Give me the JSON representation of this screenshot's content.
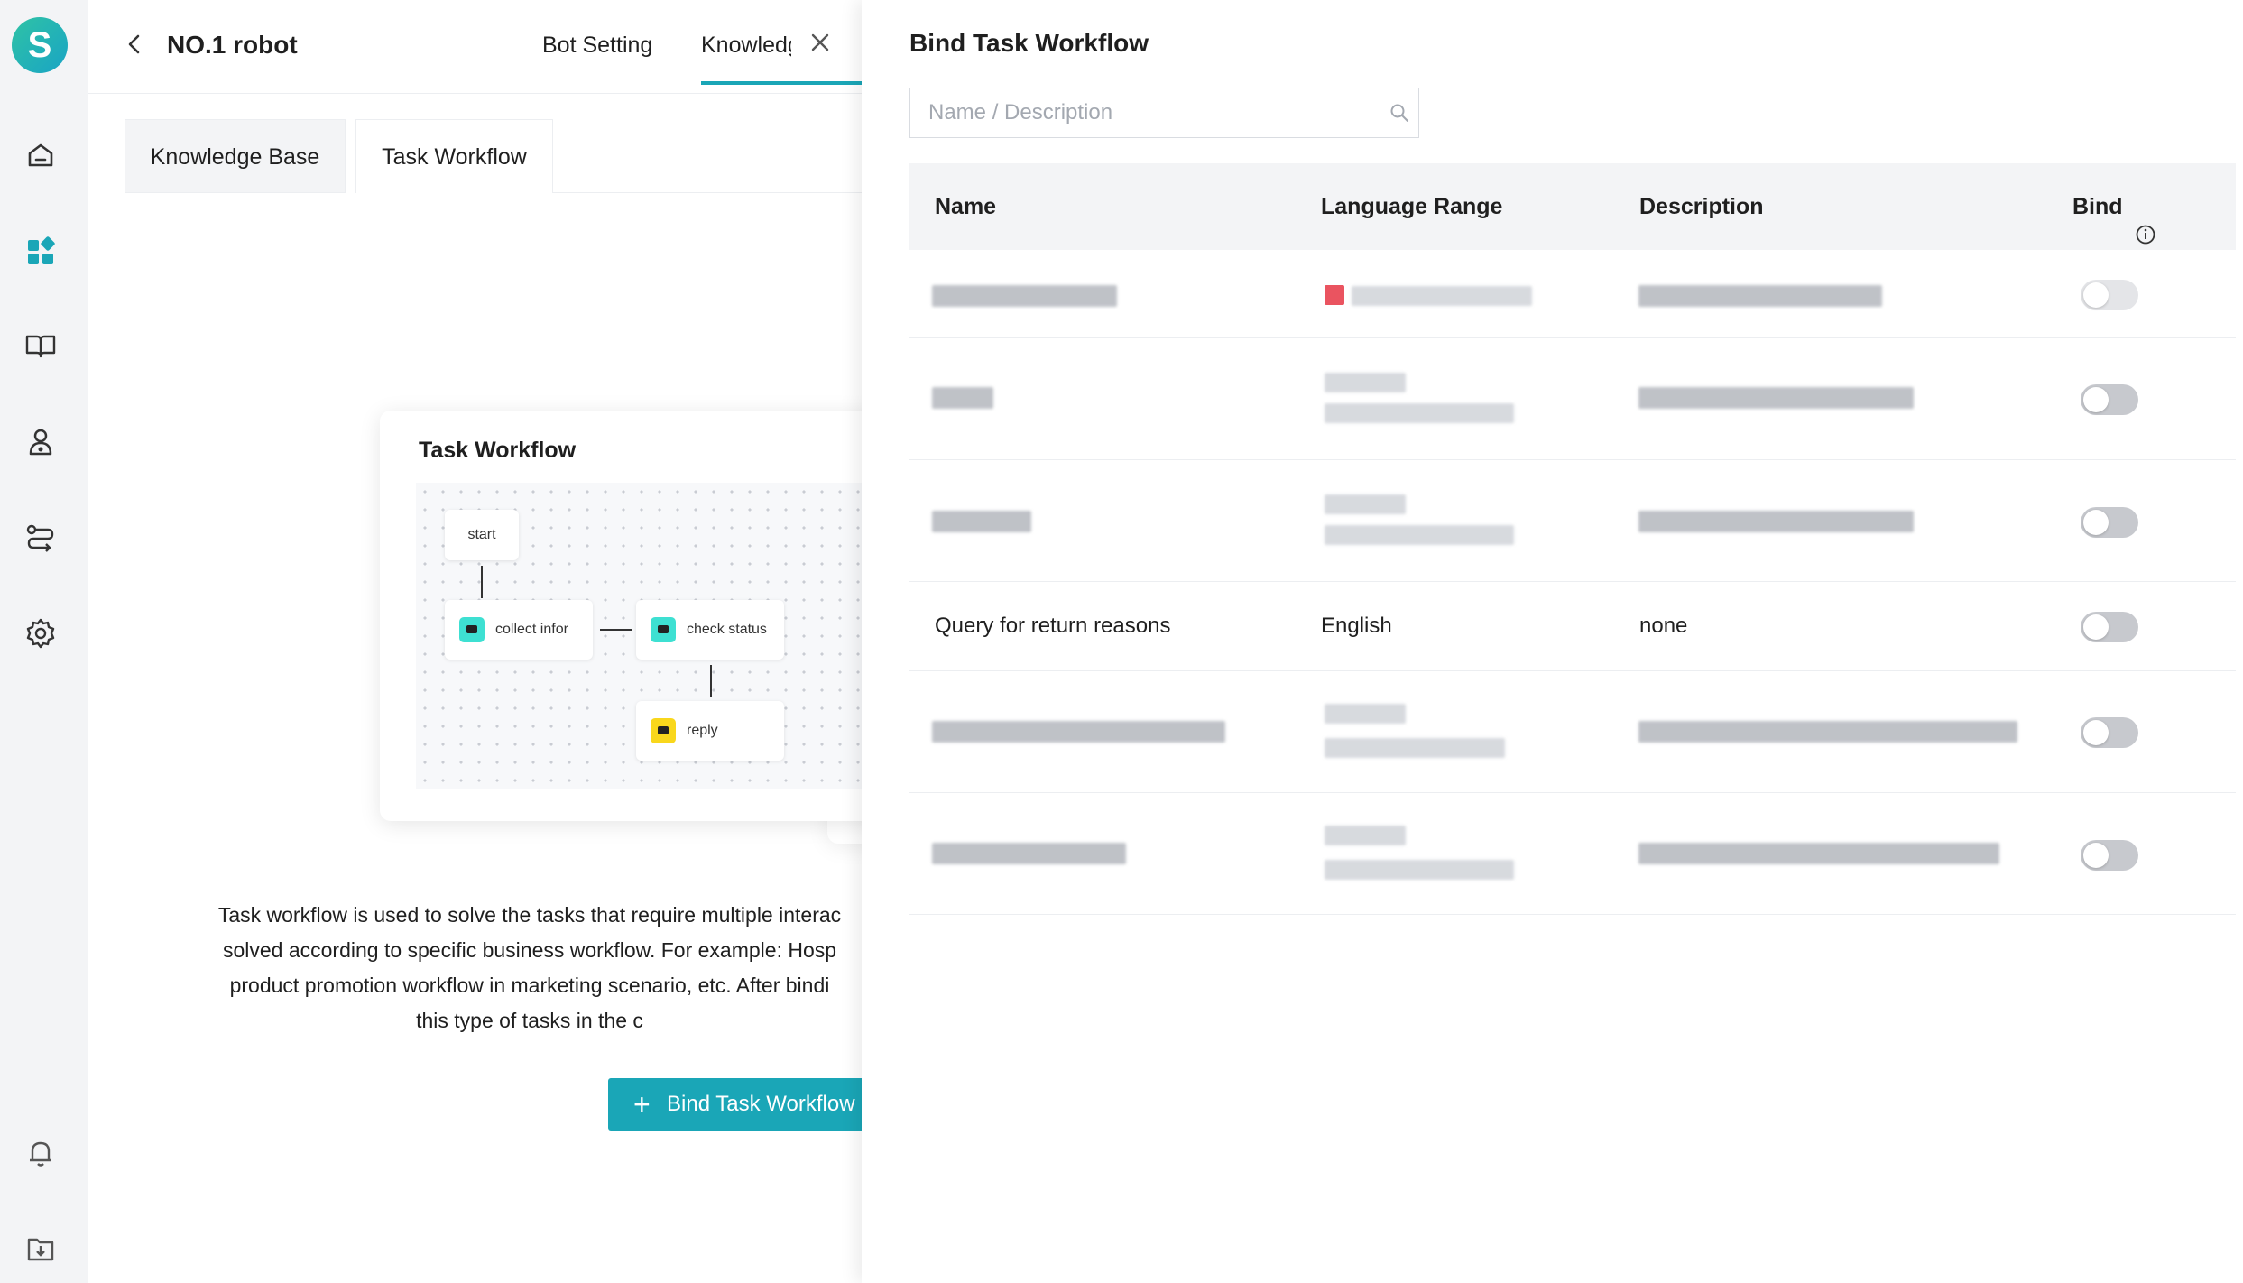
{
  "app": {
    "logo_letter": "S"
  },
  "rail": {
    "icons": [
      "home-icon",
      "apps-icon",
      "book-icon",
      "user-icon",
      "route-icon",
      "settings-icon",
      "bell-icon",
      "download-icon"
    ]
  },
  "header": {
    "robot_name": "NO.1 robot",
    "tabs": [
      "Bot Setting",
      "Knowledge"
    ],
    "active_tab": "Knowledge"
  },
  "subtabs": [
    "Knowledge Base",
    "Task Workflow"
  ],
  "active_subtab": "Task Workflow",
  "illustration": {
    "title": "Task Workflow",
    "nodes": {
      "start": "start",
      "collect": "collect infor",
      "check": "check status",
      "reply": "reply"
    }
  },
  "description": {
    "line1": "Task workflow is used to solve the tasks that require multiple interac",
    "line2": "solved according to specific business workflow. For example: Hosp",
    "line3": "product promotion workflow in marketing scenario, etc. After bindi",
    "line4": "this type of tasks in the c"
  },
  "bind_button": {
    "label": "Bind Task Workflow",
    "icon": "plus-icon"
  },
  "drawer": {
    "title": "Bind Task Workflow",
    "search_placeholder": "Name / Description",
    "columns": {
      "name": "Name",
      "language": "Language Range",
      "description": "Description",
      "bind": "Bind"
    },
    "visible_row": {
      "name": "Query for return reasons",
      "language": "English",
      "description": "none",
      "bound": false
    },
    "toggles_on": [
      false,
      false,
      false,
      false,
      false,
      false
    ]
  },
  "colors": {
    "accent": "#1aa6b7",
    "rail_bg": "#f3f4f6",
    "table_header_bg": "#f3f4f6"
  }
}
